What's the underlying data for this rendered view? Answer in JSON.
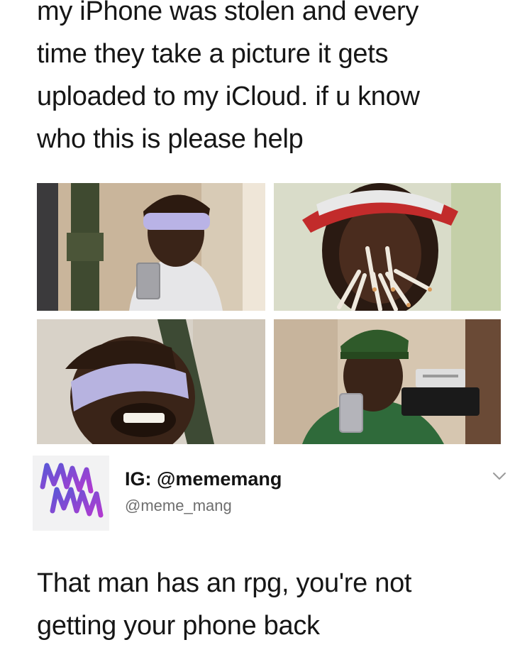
{
  "post": {
    "caption_lines": [
      "my iPhone was stolen and every",
      "time they take a picture it gets",
      "uploaded to my iCloud. if u know",
      "who this is please help"
    ]
  },
  "tweet": {
    "avatar_icon": "meme-mang-logo-icon",
    "display_name": "IG: @mememang",
    "handle": "@meme_mang",
    "menu_icon": "chevron-down-icon",
    "text_lines": [
      "That man has an rpg, you're not",
      "getting your phone back"
    ]
  },
  "colors": {
    "avatar_gradient_start": "#5b57d6",
    "avatar_gradient_end": "#b13ad0",
    "cap_red": "#c22b2b",
    "cap_green": "#2f5a2a"
  }
}
